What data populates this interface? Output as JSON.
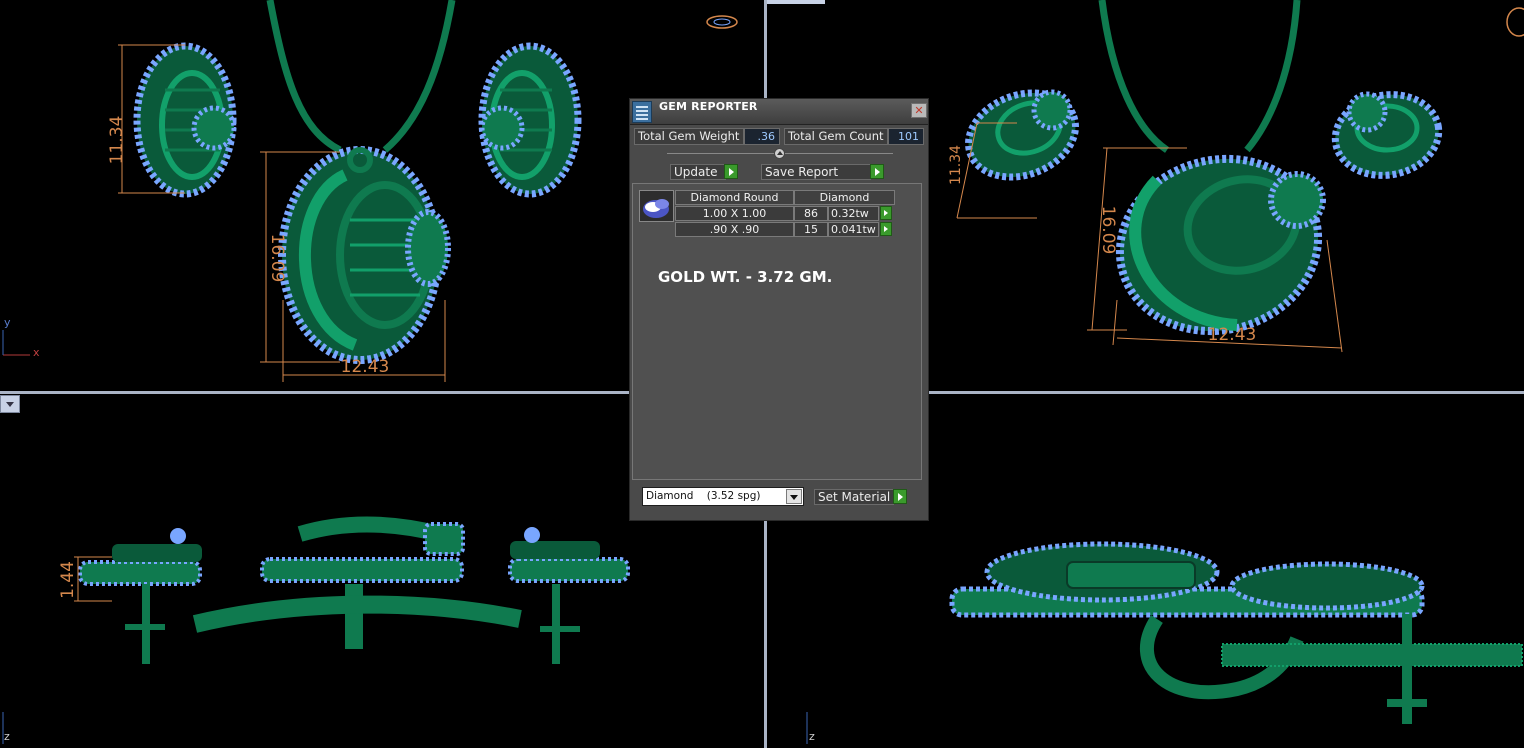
{
  "colors": {
    "metal": "#0f7a4f",
    "metal_dark": "#0a5a3a",
    "gem": "#79a6ff",
    "dimension": "#d4874c",
    "panel_bg": "#4a4a4a",
    "value_text": "#9ecaff",
    "go_button": "#3a9a2c"
  },
  "viewports": {
    "top_left": {
      "axis_y": "y",
      "axis_x": "x"
    },
    "bottom_left": {
      "axis_z": "z"
    },
    "bottom_right": {
      "axis_z": "z"
    }
  },
  "dimensions": {
    "top_left": {
      "height_earring": "11.34",
      "height_pendant": "16.09",
      "width_pendant": "12.43"
    },
    "top_right": {
      "height_earring": "11.34",
      "height_pendant": "16.09",
      "width_pendant": "12.43"
    },
    "bottom_left": {
      "thickness": "1.44"
    }
  },
  "gem_reporter": {
    "title": "GEM REPORTER",
    "close_icon": "close-icon",
    "total_gem_weight_label": "Total Gem Weight",
    "total_gem_weight_value": ".36",
    "total_gem_count_label": "Total Gem Count",
    "total_gem_count_value": "101",
    "update_label": "Update",
    "save_report_label": "Save Report",
    "table": {
      "headers": [
        "Diamond Round",
        "Diamond"
      ],
      "rows": [
        {
          "size": "1.00 X 1.00",
          "count": "86",
          "weight": "0.32tw"
        },
        {
          "size": ".90 X .90",
          "count": "15",
          "weight": "0.041tw"
        }
      ]
    },
    "gold_weight_text": "GOLD WT. - 3.72 GM.",
    "material_select": "Diamond    (3.52 spg)",
    "set_material_label": "Set Material"
  }
}
